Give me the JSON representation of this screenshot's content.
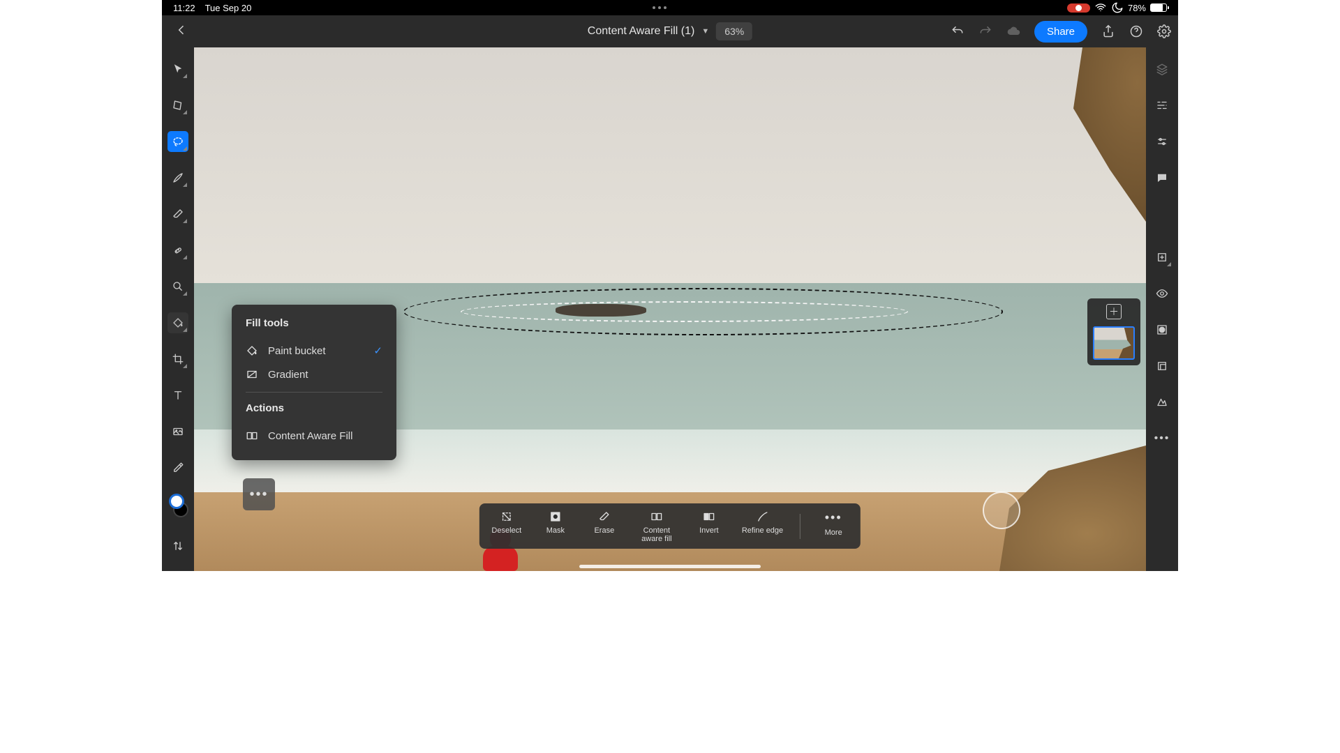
{
  "status": {
    "time": "11:22",
    "date": "Tue Sep 20",
    "battery_pct": "78%"
  },
  "header": {
    "title": "Content Aware Fill (1)",
    "zoom": "63%",
    "share": "Share"
  },
  "fill_popup": {
    "section1": "Fill tools",
    "paint_bucket": "Paint bucket",
    "gradient": "Gradient",
    "section2": "Actions",
    "caf": "Content Aware Fill"
  },
  "bottom": {
    "deselect": "Deselect",
    "mask": "Mask",
    "erase": "Erase",
    "caf": "Content aware fill",
    "invert": "Invert",
    "refine": "Refine edge",
    "more": "More"
  }
}
